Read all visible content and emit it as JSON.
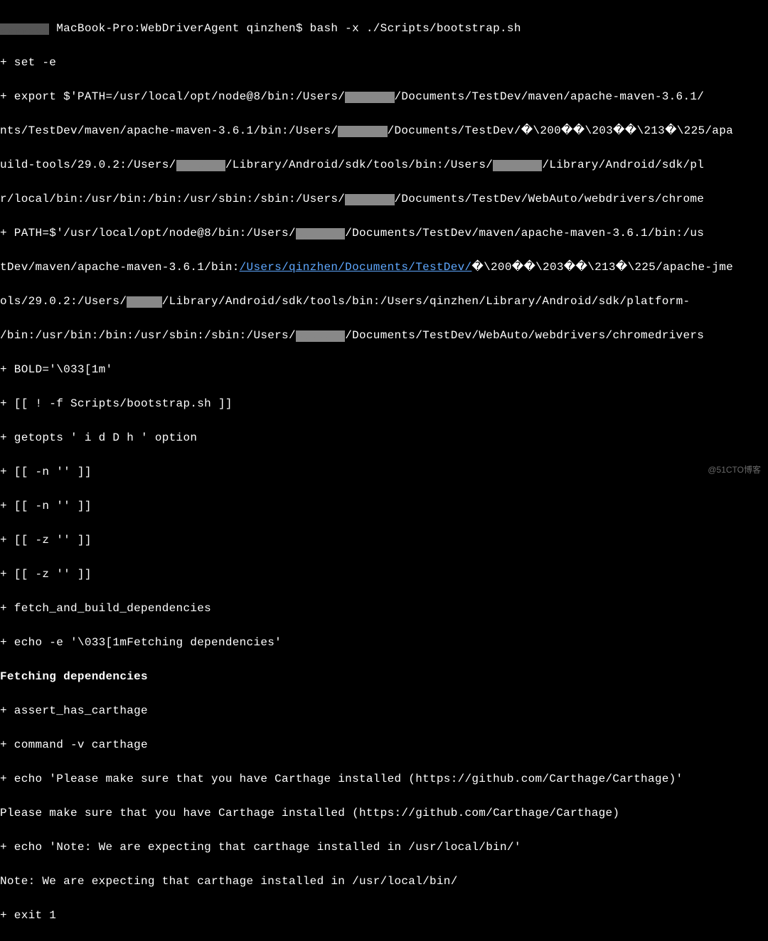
{
  "prompt": {
    "host_prefix": " MacBook-Pro:WebDriverAgent qinzhen$ ",
    "command": "bash -x ./Scripts/bootstrap.sh"
  },
  "lines": {
    "l1": "+ set -e",
    "l2a": "+ export $'PATH=/usr/local/opt/node@8/bin:/Users/",
    "l2b": "/Documents/TestDev/maven/apache-maven-3.6.1/",
    "l3a": "nts/TestDev/maven/apache-maven-3.6.1/bin:/Users/",
    "l3b": "/Documents/TestDev/�\\200��\\203��\\213�\\225/apa",
    "l4a": "uild-tools/29.0.2:/Users/",
    "l4b": "/Library/Android/sdk/tools/bin:/Users/",
    "l4c": "/Library/Android/sdk/pl",
    "l5a": "r/local/bin:/usr/bin:/bin:/usr/sbin:/sbin:/Users/",
    "l5b": "/Documents/TestDev/WebAuto/webdrivers/chrome",
    "l6a": "+ PATH=$'/usr/local/opt/node@8/bin:/Users/",
    "l6b": "/Documents/TestDev/maven/apache-maven-3.6.1/bin:/us",
    "l7a": "tDev/maven/apache-maven-3.6.1/bin:",
    "l7link": "/Users/qinzhen/Documents/TestDev/",
    "l7b": "�\\200��\\203��\\213�\\225/apache-jme",
    "l8a": "ols/29.0.2:/Users/",
    "l8b": "/Library/Android/sdk/tools/bin:/Users/qinzhen/Library/Android/sdk/platform-",
    "l9a": "/bin:/usr/bin:/bin:/usr/sbin:/sbin:/Users/",
    "l9b": "/Documents/TestDev/WebAuto/webdrivers/chromedrivers",
    "l10": "+ BOLD='\\033[1m'",
    "l11": "+ [[ ! -f Scripts/bootstrap.sh ]]",
    "l12": "+ getopts ' i d D h ' option",
    "l13": "+ [[ -n '' ]]",
    "l14": "+ [[ -n '' ]]",
    "l15": "+ [[ -z '' ]]",
    "l16": "+ [[ -z '' ]]",
    "l17": "+ fetch_and_build_dependencies",
    "l18": "+ echo -e '\\033[1mFetching dependencies'",
    "l19": "Fetching dependencies",
    "l20": "+ assert_has_carthage",
    "l21": "+ command -v carthage",
    "l22": "+ echo 'Please make sure that you have Carthage installed (https://github.com/Carthage/Carthage)'",
    "l23": "Please make sure that you have Carthage installed (https://github.com/Carthage/Carthage)",
    "l24": "+ echo 'Note: We are expecting that carthage installed in /usr/local/bin/'",
    "l25": "Note: We are expecting that carthage installed in /usr/local/bin/",
    "l26": "+ exit 1"
  },
  "watermark": "@51CTO博客"
}
